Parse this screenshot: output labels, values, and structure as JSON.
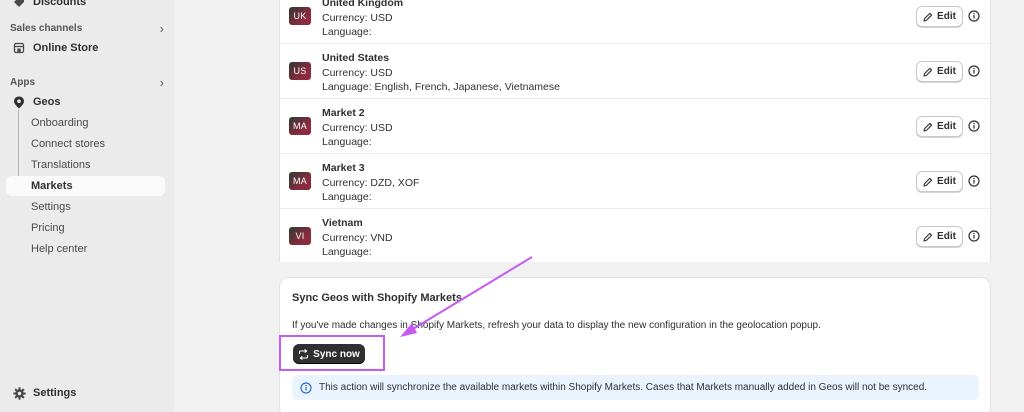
{
  "sidebar": {
    "discounts_label": "Discounts",
    "sales_channels_header": "Sales channels",
    "online_store_label": "Online Store",
    "apps_header": "Apps",
    "geos_label": "Geos",
    "sub_items": [
      {
        "label": "Onboarding"
      },
      {
        "label": "Connect stores"
      },
      {
        "label": "Translations"
      },
      {
        "label": "Markets"
      },
      {
        "label": "Settings"
      },
      {
        "label": "Pricing"
      },
      {
        "label": "Help center"
      }
    ],
    "settings_label": "Settings"
  },
  "markets": [
    {
      "code": "UK",
      "name": "United Kingdom",
      "currency": "Currency: USD",
      "language": "Language:",
      "edit_label": "Edit",
      "color": "#8e2a3f"
    },
    {
      "code": "US",
      "name": "United States",
      "currency": "Currency: USD",
      "language": "Language: English, French, Japanese, Vietnamese",
      "edit_label": "Edit",
      "color": "#8e2a3f"
    },
    {
      "code": "MA",
      "name": "Market 2",
      "currency": "Currency: USD",
      "language": "Language:",
      "edit_label": "Edit",
      "color": "#8e2a3f"
    },
    {
      "code": "MA",
      "name": "Market 3",
      "currency": "Currency: DZD, XOF",
      "language": "Language:",
      "edit_label": "Edit",
      "color": "#8e2a3f"
    },
    {
      "code": "VI",
      "name": "Vietnam",
      "currency": "Currency: VND",
      "language": "Language:",
      "edit_label": "Edit",
      "color": "#8e2a3f"
    }
  ],
  "sync": {
    "title": "Sync Geos with Shopify Markets",
    "description": "If you've made changes in Shopify Markets, refresh your data to display the new configuration in the geolocation popup.",
    "button_label": "Sync now",
    "banner_text": "This action will synchronize the available markets within Shopify Markets. Cases that Markets manually added in Geos will not be synced."
  },
  "colors": {
    "annotation": "#c75af2",
    "info_blue": "#2c6ecb",
    "banner_bg": "#eaf4ff",
    "primary_button": "#303030"
  }
}
